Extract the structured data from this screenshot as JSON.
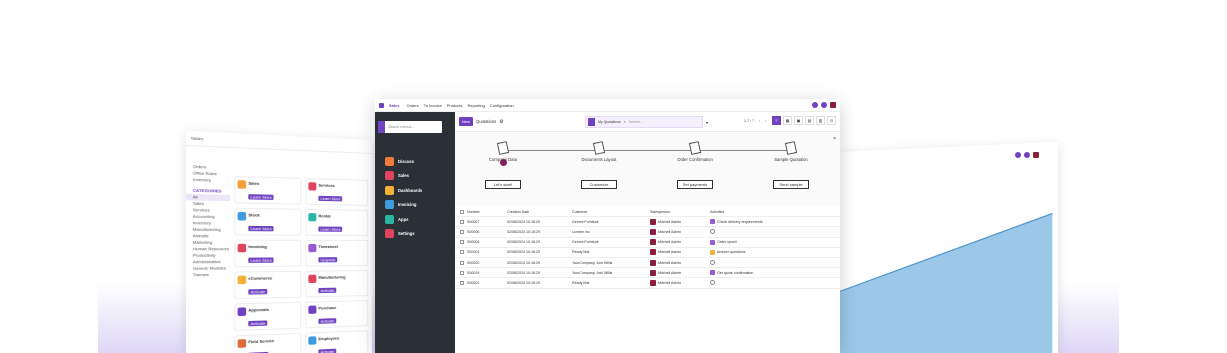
{
  "colors": {
    "accent": "#6f42c1",
    "sidebar_bg": "#2b2f36",
    "avatar": "#8b1e3a",
    "glow": "#d8d0f5"
  },
  "left_panel": {
    "title": "Tables",
    "side_items": [
      "Orders",
      "Office Rules",
      "Inventory",
      "CATEGORIES",
      "All",
      "Sales",
      "Services",
      "Accounting",
      "Inventory",
      "Manufacturing",
      "Website",
      "Marketing",
      "Human Resources",
      "Productivity",
      "Administration",
      "Generic Modules",
      "Themes"
    ],
    "cards": [
      {
        "name": "Sales",
        "btn": "Learn More",
        "color": "#f29d38"
      },
      {
        "name": "Services",
        "btn": "Learn More",
        "color": "#e0435d"
      },
      {
        "name": "Stock",
        "btn": "Learn More",
        "color": "#3f9be0"
      },
      {
        "name": "Rental",
        "btn": "Learn More",
        "color": "#2ab6a6"
      },
      {
        "name": "Invoicing",
        "btn": "Learn More",
        "color": "#e0435d"
      },
      {
        "name": "Timesheet",
        "btn": "Upgrade",
        "color": "#9b59d0"
      },
      {
        "name": "eCommerce",
        "btn": "Activate",
        "color": "#f2b134"
      },
      {
        "name": "Manufacturing",
        "btn": "Activate",
        "color": "#e0435d"
      },
      {
        "name": "Approvals",
        "btn": "Activate",
        "color": "#6f42c1"
      },
      {
        "name": "Purchase",
        "btn": "Activate",
        "color": "#6f42c1"
      },
      {
        "name": "Field Service",
        "btn": "Upgrade",
        "color": "#e06a3a"
      },
      {
        "name": "Employees",
        "btn": "Activate",
        "color": "#3f9be0"
      }
    ]
  },
  "window": {
    "app_title": "Sales",
    "menu": [
      "Orders",
      "To Invoice",
      "Products",
      "Reporting",
      "Configuration"
    ]
  },
  "sidebar": {
    "search_placeholder": "Search menus...",
    "items": [
      {
        "label": "Discuss",
        "icon": "discuss-icon",
        "color": "#f47a3a"
      },
      {
        "label": "Sales",
        "icon": "sales-icon",
        "color": "#e0435d"
      },
      {
        "label": "Dashboards",
        "icon": "dashboards-icon",
        "color": "#f2b134"
      },
      {
        "label": "Invoicing",
        "icon": "invoicing-icon",
        "color": "#3f9be0"
      },
      {
        "label": "Apps",
        "icon": "apps-icon",
        "color": "#2ab6a6"
      },
      {
        "label": "Settings",
        "icon": "settings-icon",
        "color": "#e0435d"
      }
    ]
  },
  "control_bar": {
    "new_label": "New",
    "title": "Quotations",
    "filter_chip": "My Quotations",
    "search_placeholder": "Search...",
    "pager": "1-7 / 7"
  },
  "onboarding": {
    "steps": [
      {
        "label": "Company Data",
        "button": "Let's start!"
      },
      {
        "label": "Documents Layout",
        "button": "Customize"
      },
      {
        "label": "Order Confirmation",
        "button": "Set payments"
      },
      {
        "label": "Sample Quotation",
        "button": "Send sample"
      }
    ]
  },
  "table": {
    "headers": [
      "Number",
      "Creation Date",
      "Customer",
      "Salesperson",
      "Activities"
    ],
    "rows": [
      {
        "number": "S00007",
        "date": "02/08/2024 10:18:29",
        "customer": "Gemini Furniture",
        "salesperson": "Mitchell Admin",
        "activity": "Check delivery requirements",
        "act_color": "#9b59d0"
      },
      {
        "number": "S00006",
        "date": "02/08/2024 10:18:29",
        "customer": "Lumber Inc",
        "salesperson": "Mitchell Admin",
        "activity": "",
        "act_color": "#ffffff"
      },
      {
        "number": "S00004",
        "date": "02/08/2024 10:18:29",
        "customer": "Gemini Furniture",
        "salesperson": "Mitchell Admin",
        "activity": "Order upsell",
        "act_color": "#9b59d0"
      },
      {
        "number": "S00003",
        "date": "02/08/2024 10:18:29",
        "customer": "Ready Mat",
        "salesperson": "Mitchell Admin",
        "activity": "Answer questions",
        "act_color": "#f2b134"
      },
      {
        "number": "S00020",
        "date": "02/08/2024 10:18:29",
        "customer": "YourCompany, Joel Willis",
        "salesperson": "Mitchell Admin",
        "activity": "",
        "act_color": "#ffffff"
      },
      {
        "number": "S00019",
        "date": "02/08/2024 10:18:29",
        "customer": "YourCompany, Joel Willis",
        "salesperson": "Mitchell Admin",
        "activity": "Get quote confirmation",
        "act_color": "#9b59d0"
      },
      {
        "number": "S00002",
        "date": "02/08/2024 10:18:29",
        "customer": "Ready Mat",
        "salesperson": "Mitchell Admin",
        "activity": "",
        "act_color": "#ffffff"
      }
    ]
  }
}
